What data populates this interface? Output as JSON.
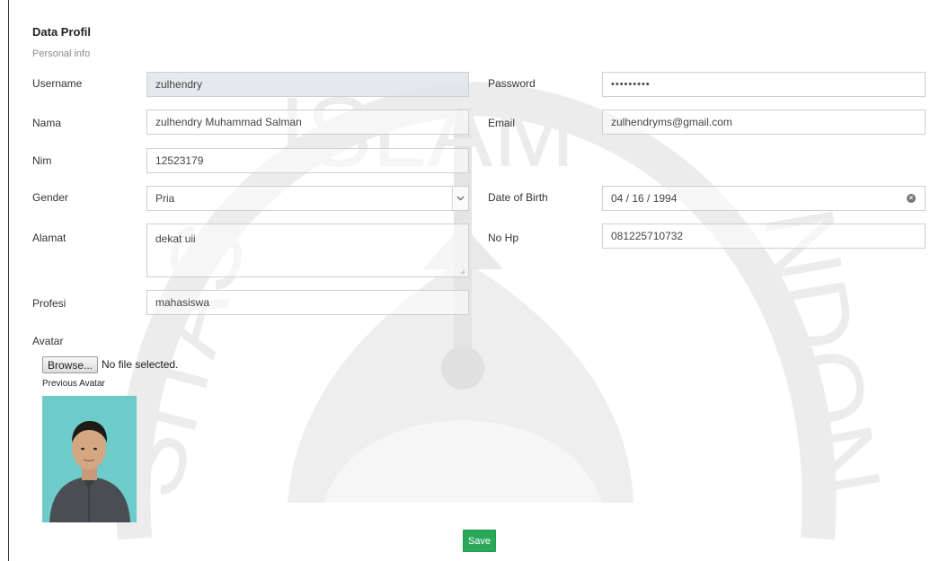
{
  "header": {
    "title": "Data Profil",
    "subtitle": "Personal info"
  },
  "form": {
    "username": {
      "label": "Username",
      "value": "zulhendry"
    },
    "password": {
      "label": "Password",
      "value": "•••••••••"
    },
    "nama": {
      "label": "Nama",
      "value": "zulhendry Muhammad Salman"
    },
    "email": {
      "label": "Email",
      "value": "zulhendryms@gmail.com"
    },
    "nim": {
      "label": "Nim",
      "value": "12523179"
    },
    "gender": {
      "label": "Gender",
      "value": "Pria"
    },
    "dob": {
      "label": "Date of Birth",
      "value": "04 / 16 / 1994"
    },
    "alamat": {
      "label": "Alamat",
      "value": "dekat uii"
    },
    "nohp": {
      "label": "No Hp",
      "value": "081225710732"
    },
    "profesi": {
      "label": "Profesi",
      "value": "mahasiswa"
    },
    "avatar": {
      "label": "Avatar",
      "browse_label": "Browse...",
      "file_status": "No file selected.",
      "previous_label": "Previous Avatar"
    },
    "save_label": "Save"
  },
  "watermark": {
    "text_top": "ISLAM",
    "text_left": "SITAS",
    "text_right": "NDON"
  },
  "colors": {
    "save_button": "#2aa85a",
    "avatar_background": "#6dcbc9",
    "readonly_field": "#e1e5ea"
  }
}
